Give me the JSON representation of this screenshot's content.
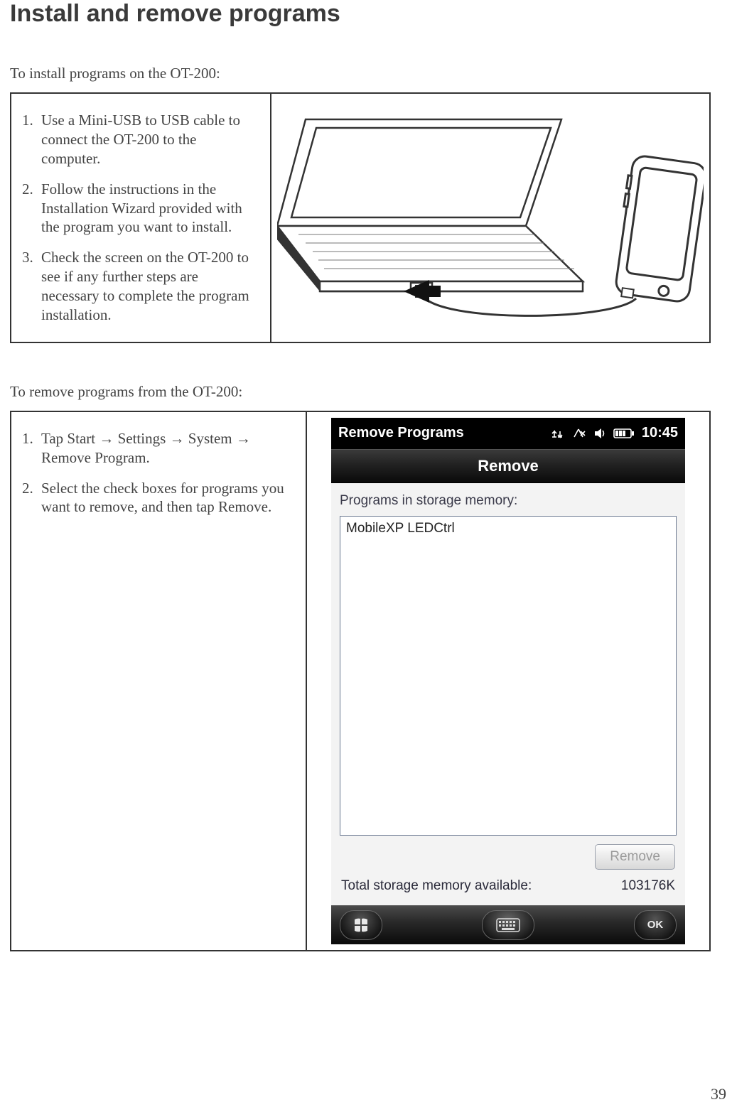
{
  "page": {
    "title": "Install and remove programs",
    "number": "39"
  },
  "install": {
    "intro": "To install programs on the OT-200:",
    "steps": [
      "Use a Mini-USB to USB  cable to connect the OT-200 to the computer.",
      "Follow the instructions in the Installation Wizard provided with the program you want to install.",
      "Check the screen on the OT-200 to see if any further steps are necessary to complete the program installation."
    ]
  },
  "remove": {
    "intro": "To remove programs from the OT-200:",
    "steps": [
      "Tap Start → Settings → System → Remove Program.",
      "Select the check boxes for programs you want to remove, and then tap Remove."
    ]
  },
  "wm_screenshot": {
    "titlebar": {
      "title": "Remove Programs",
      "time": "10:45"
    },
    "tabs": {
      "remove": "Remove"
    },
    "body": {
      "programs_label": "Programs in storage memory:",
      "program_items": [
        "MobileXP LEDCtrl"
      ],
      "remove_button": "Remove",
      "storage_label": "Total storage memory available:",
      "storage_value": "103176K"
    },
    "bottombar": {
      "ok": "OK"
    }
  }
}
